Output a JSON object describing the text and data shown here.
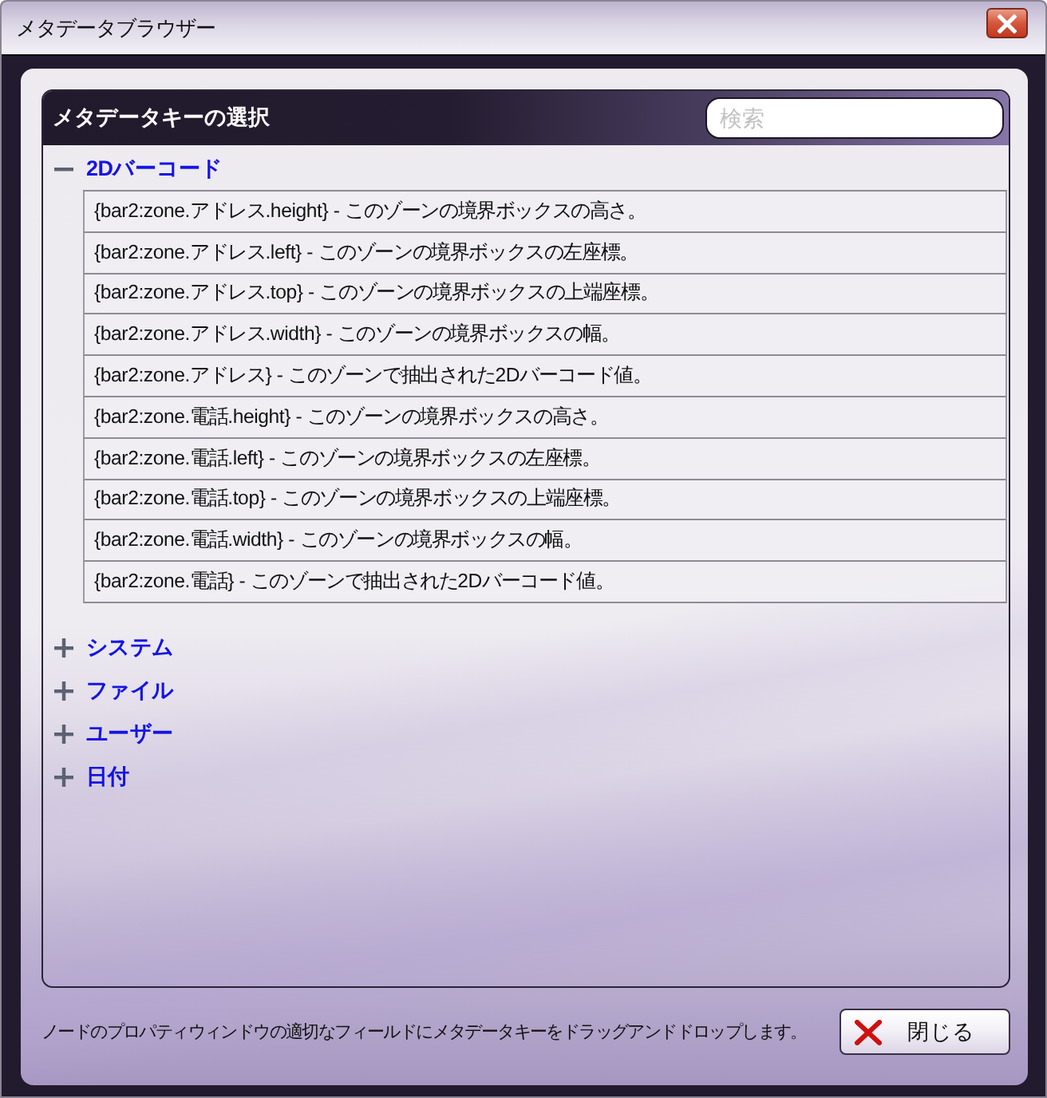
{
  "window": {
    "title": "メタデータブラウザー"
  },
  "group": {
    "title": "メタデータキーの選択",
    "search": {
      "placeholder": "検索"
    }
  },
  "tree": [
    {
      "label": "2Dバーコード",
      "expanded": true,
      "children": [
        {
          "label": "{bar2:zone.アドレス.height} - このゾーンの境界ボックスの高さ。"
        },
        {
          "label": "{bar2:zone.アドレス.left} - このゾーンの境界ボックスの左座標。"
        },
        {
          "label": "{bar2:zone.アドレス.top} - このゾーンの境界ボックスの上端座標。"
        },
        {
          "label": "{bar2:zone.アドレス.width} - このゾーンの境界ボックスの幅。"
        },
        {
          "label": "{bar2:zone.アドレス} - このゾーンで抽出された2Dバーコード値。"
        },
        {
          "label": "{bar2:zone.電話.height} - このゾーンの境界ボックスの高さ。"
        },
        {
          "label": "{bar2:zone.電話.left} - このゾーンの境界ボックスの左座標。"
        },
        {
          "label": "{bar2:zone.電話.top} - このゾーンの境界ボックスの上端座標。"
        },
        {
          "label": "{bar2:zone.電話.width} - このゾーンの境界ボックスの幅。"
        },
        {
          "label": "{bar2:zone.電話} - このゾーンで抽出された2Dバーコード値。"
        }
      ]
    },
    {
      "label": "システム",
      "expanded": false
    },
    {
      "label": "ファイル",
      "expanded": false
    },
    {
      "label": "ユーザー",
      "expanded": false
    },
    {
      "label": "日付",
      "expanded": false
    }
  ],
  "footer": {
    "hint": "ノードのプロパティウィンドウの適切なフィールドにメタデータキーをドラッグアンドドロップします。",
    "close_button": "閉じる"
  }
}
